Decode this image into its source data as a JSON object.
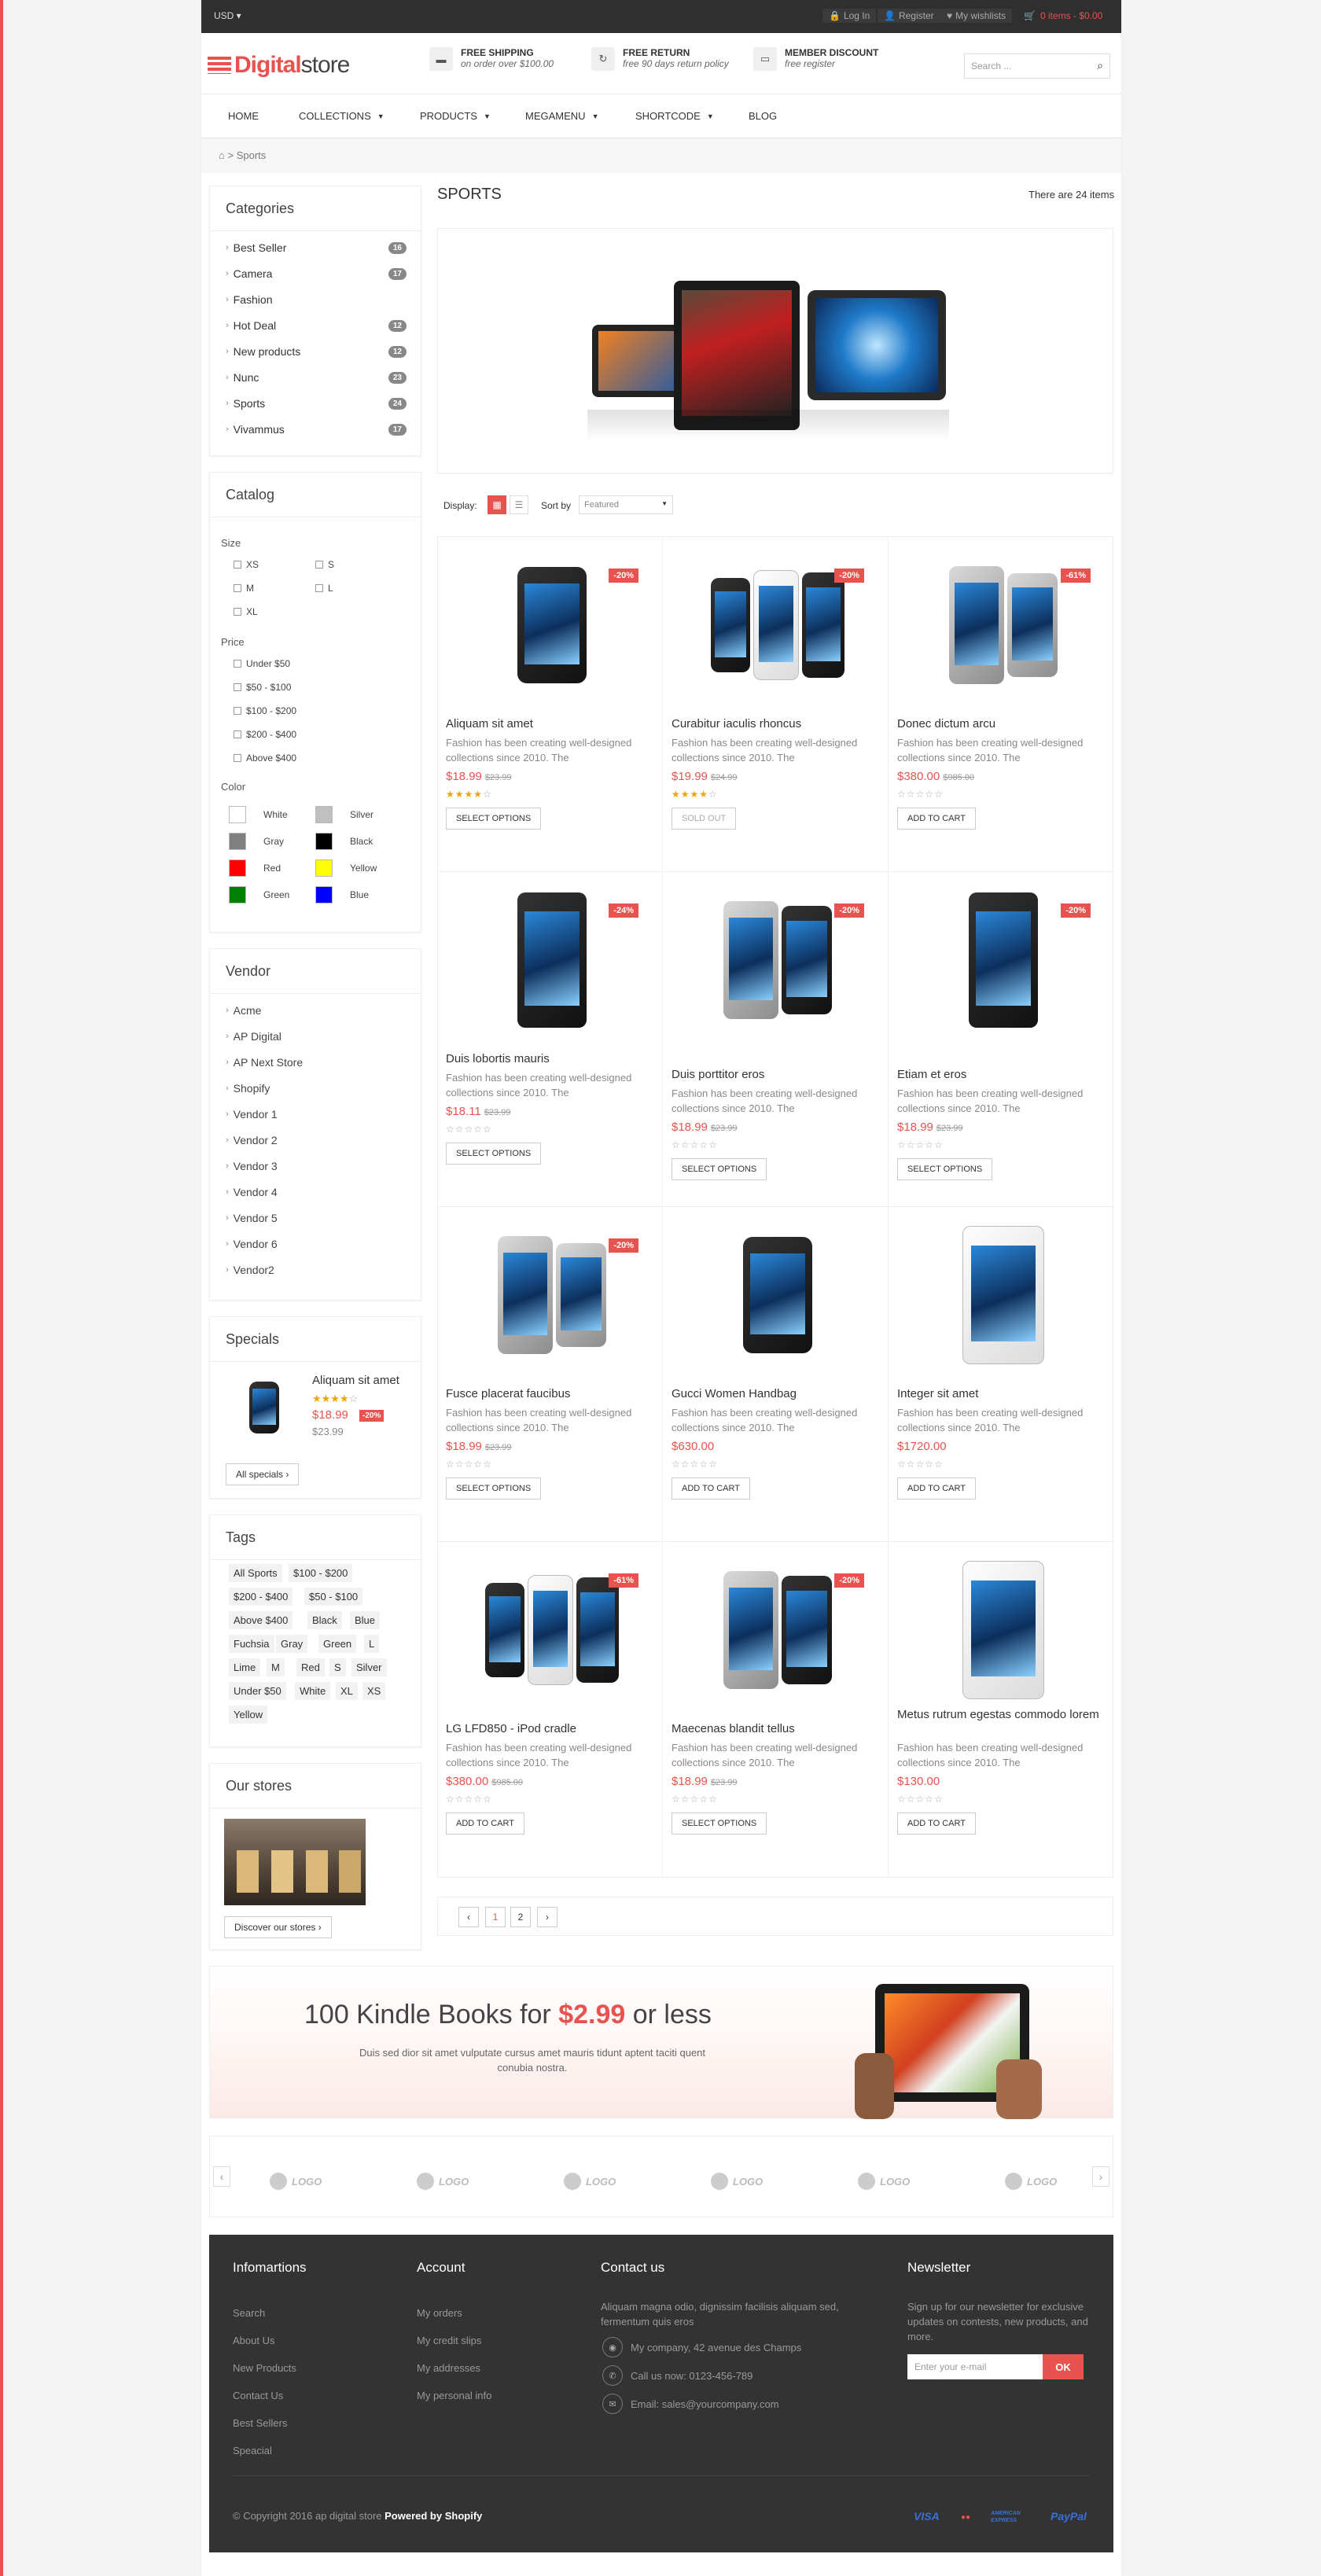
{
  "topbar": {
    "currency": "USD",
    "login": "Log In",
    "register": "Register",
    "wishlist": "My wishlists",
    "cart": "0 items - $0.00"
  },
  "logo": {
    "brand": "Digital",
    "rest": "store"
  },
  "features": [
    {
      "title": "FREE SHIPPING",
      "sub": "on order over $100.00",
      "icon": "truck-icon"
    },
    {
      "title": "FREE RETURN",
      "sub": "free 90 days return policy",
      "icon": "refresh-icon"
    },
    {
      "title": "MEMBER DISCOUNT",
      "sub": "free register",
      "icon": "card-icon"
    }
  ],
  "search": {
    "placeholder": "Search ..."
  },
  "nav": [
    "HOME",
    "COLLECTIONS",
    "PRODUCTS",
    "MEGAMENU",
    "SHORTCODE",
    "BLOG"
  ],
  "breadcrumb": {
    "current": "> Sports"
  },
  "categories": {
    "title": "Categories",
    "items": [
      {
        "label": "Best Seller",
        "count": "16"
      },
      {
        "label": "Camera",
        "count": "17"
      },
      {
        "label": "Fashion",
        "count": ""
      },
      {
        "label": "Hot Deal",
        "count": "12"
      },
      {
        "label": "New products",
        "count": "12"
      },
      {
        "label": "Nunc",
        "count": "23"
      },
      {
        "label": "Sports",
        "count": "24"
      },
      {
        "label": "Vivammus",
        "count": "17"
      }
    ]
  },
  "catalog": {
    "title": "Catalog",
    "size_label": "Size",
    "sizes": [
      "XS",
      "S",
      "M",
      "L",
      "XL"
    ],
    "price_label": "Price",
    "prices": [
      "Under $50",
      "$50 - $100",
      "$100 - $200",
      "$200 - $400",
      "Above $400"
    ],
    "color_label": "Color",
    "colors": [
      {
        "name": "White",
        "hex": "#ffffff"
      },
      {
        "name": "Silver",
        "hex": "#c0c0c0"
      },
      {
        "name": "Gray",
        "hex": "#808080"
      },
      {
        "name": "Black",
        "hex": "#000000"
      },
      {
        "name": "Red",
        "hex": "#ff0000"
      },
      {
        "name": "Yellow",
        "hex": "#ffff00"
      },
      {
        "name": "Green",
        "hex": "#008000"
      },
      {
        "name": "Blue",
        "hex": "#0000ff"
      }
    ]
  },
  "vendor": {
    "title": "Vendor",
    "items": [
      "Acme",
      "AP Digital",
      "AP Next Store",
      "Shopify",
      "Vendor 1",
      "Vendor 2",
      "Vendor 3",
      "Vendor 4",
      "Vendor 5",
      "Vendor 6",
      "Vendor2"
    ]
  },
  "specials": {
    "title": "Specials",
    "name": "Aliquam sit amet",
    "price": "$18.99",
    "sale": "-20%",
    "old": "$23.99",
    "rating": 4,
    "button": "All specials"
  },
  "tags": {
    "title": "Tags",
    "items": [
      "All Sports",
      "$100 - $200",
      "$200 - $400",
      "$50 - $100",
      "Above $400",
      "Black",
      "Blue",
      "Fuchsia",
      "Gray",
      "Green",
      "L",
      "Lime",
      "M",
      "Red",
      "S",
      "Silver",
      "Under $50",
      "White",
      "XL",
      "XS",
      "Yellow"
    ]
  },
  "stores": {
    "title": "Our stores",
    "button": "Discover our stores"
  },
  "main": {
    "title": "SPORTS",
    "count": "There are 24 items",
    "display": "Display:",
    "sortby": "Sort by",
    "sort_value": "Featured"
  },
  "products": [
    {
      "name": "Aliquam sit amet",
      "desc": "Fashion has been creating well-designed collections since 2010. The",
      "price": "$18.99",
      "old": "$23.99",
      "sale": "-20%",
      "rating": 4,
      "button": "SELECT OPTIONS",
      "disabled": false
    },
    {
      "name": "Curabitur iaculis rhoncus",
      "desc": "Fashion has been creating well-designed collections since 2010. The",
      "price": "$19.99",
      "old": "$24.99",
      "sale": "-20%",
      "rating": 4,
      "button": "SOLD OUT",
      "disabled": true
    },
    {
      "name": "Donec dictum arcu",
      "desc": "Fashion has been creating well-designed collections since 2010. The",
      "price": "$380.00",
      "old": "$985.00",
      "sale": "-61%",
      "rating": 0,
      "button": "ADD TO CART",
      "disabled": false
    },
    {
      "name": "Duis lobortis mauris",
      "desc": "Fashion has been creating well-designed collections since 2010. The",
      "price": "$18.11",
      "old": "$23.99",
      "sale": "-24%",
      "rating": 0,
      "button": "SELECT OPTIONS",
      "disabled": false
    },
    {
      "name": "Duis porttitor eros",
      "desc": "Fashion has been creating well-designed collections since 2010. The",
      "price": "$18.99",
      "old": "$23.99",
      "sale": "-20%",
      "rating": 0,
      "button": "SELECT OPTIONS",
      "disabled": false
    },
    {
      "name": "Etiam et eros",
      "desc": "Fashion has been creating well-designed collections since 2010. The",
      "price": "$18.99",
      "old": "$23.99",
      "sale": "-20%",
      "rating": 0,
      "button": "SELECT OPTIONS",
      "disabled": false
    },
    {
      "name": "Fusce placerat faucibus",
      "desc": "Fashion has been creating well-designed collections since 2010. The",
      "price": "$18.99",
      "old": "$23.99",
      "sale": "-20%",
      "rating": 0,
      "button": "SELECT OPTIONS",
      "disabled": false
    },
    {
      "name": "Gucci Women Handbag",
      "desc": "Fashion has been creating well-designed collections since 2010. The",
      "price": "$630.00",
      "old": "",
      "sale": "",
      "rating": 0,
      "button": "ADD TO CART",
      "disabled": false
    },
    {
      "name": "Integer sit amet",
      "desc": "Fashion has been creating well-designed collections since 2010. The",
      "price": "$1720.00",
      "old": "",
      "sale": "",
      "rating": 0,
      "button": "ADD TO CART",
      "disabled": false
    },
    {
      "name": "LG LFD850 - iPod cradle",
      "desc": "Fashion has been creating well-designed collections since 2010. The",
      "price": "$380.00",
      "old": "$985.00",
      "sale": "-61%",
      "rating": 0,
      "button": "ADD TO CART",
      "disabled": false
    },
    {
      "name": "Maecenas blandit tellus",
      "desc": "Fashion has been creating well-designed collections since 2010. The",
      "price": "$18.99",
      "old": "$23.99",
      "sale": "-20%",
      "rating": 0,
      "button": "SELECT OPTIONS",
      "disabled": false
    },
    {
      "name": "Metus rutrum egestas commodo lorem",
      "desc": "Fashion has been creating well-designed collections since 2010. The",
      "price": "$130.00",
      "old": "",
      "sale": "",
      "rating": 0,
      "button": "ADD TO CART",
      "disabled": false
    }
  ],
  "pagination": {
    "pages": [
      "1",
      "2"
    ]
  },
  "kindle": {
    "pre": "100 Kindle Books for ",
    "price": "$2.99",
    "post": " or less",
    "desc": "Duis sed dior sit amet vulputate cursus amet mauris tidunt aptent taciti quent conubia nostra."
  },
  "logos": [
    "LOGO",
    "LOGO",
    "LOGO",
    "LOGO",
    "LOGO",
    "LOGO"
  ],
  "footer": {
    "info_title": "Infomartions",
    "info": [
      "Search",
      "About Us",
      "New Products",
      "Contact Us",
      "Best Sellers",
      "Speacial"
    ],
    "account_title": "Account",
    "account": [
      "My orders",
      "My credit slips",
      "My addresses",
      "My personal info"
    ],
    "contact_title": "Contact us",
    "contact_text": "Aliquam magna odio, dignissim facilisis aliquam sed, fermentum quis eros",
    "address": "My company, 42 avenue des Champs",
    "phone": "Call us now: 0123-456-789",
    "email": "Email: sales@yourcompany.com",
    "news_title": "Newsletter",
    "news_text": "Sign up for our newsletter for exclusive updates on contests, new products, and more.",
    "news_placeholder": "Enter your e-mail",
    "news_btn": "OK",
    "copy": "© Copyright 2016 ap digital store ",
    "powered": "Powered by Shopify",
    "payments": [
      "VISA",
      "●●",
      "AMERICAN EXPRESS",
      "PayPal"
    ]
  }
}
